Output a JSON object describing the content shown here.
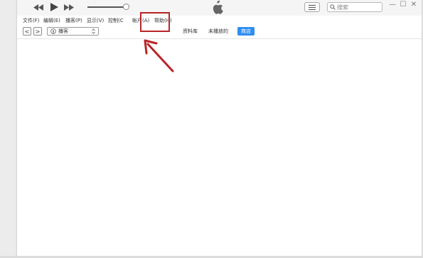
{
  "window": {
    "titlebar": {
      "search_placeholder": "搜索",
      "icons": [
        "rewind-icon",
        "play-icon",
        "fast-forward-icon",
        "volume-slider",
        "apple-logo-icon",
        "list-view-icon",
        "search-icon"
      ],
      "window_controls": [
        "—",
        "☐",
        "✕"
      ]
    },
    "menu": {
      "items": [
        "文件(F)",
        "编辑(E)",
        "播客(P)",
        "显示(V)",
        "控制(C)",
        "帐户(A)",
        "帮助(H)"
      ]
    },
    "toolbar": {
      "back": "<",
      "forward": ">",
      "media_selector": "播客",
      "media_selector_chevron": "⌃⌄",
      "tabs": [
        "资料库",
        "未播放的",
        "商店"
      ],
      "active_tab": "商店"
    }
  },
  "annotation": {
    "highlight_color": "#b92428",
    "highlighted_item": "帐户(A)"
  },
  "colors": {
    "accent": "#2e8ef1",
    "annotation": "#b92428"
  }
}
